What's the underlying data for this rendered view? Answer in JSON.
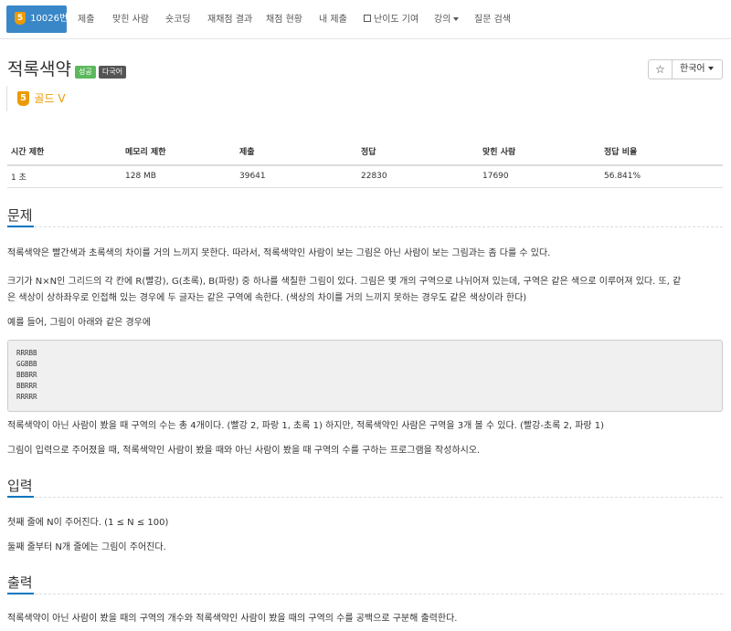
{
  "nav": {
    "active": {
      "tier_glyph": "5",
      "label": "10026번"
    },
    "items": [
      {
        "label": "제출"
      },
      {
        "label": "맞힌 사람"
      },
      {
        "label": "숏코딩"
      },
      {
        "label": "재채점 결과"
      },
      {
        "label": "채점 현황"
      },
      {
        "label": "내 제출"
      },
      {
        "label": "난이도 기여"
      },
      {
        "label": "강의"
      },
      {
        "label": "질문 검색"
      }
    ]
  },
  "problem": {
    "title": "적록색약",
    "labels": [
      "성공",
      "다국어"
    ],
    "tier_glyph": "5",
    "tier": "골드 V",
    "star": "☆",
    "language": "한국어"
  },
  "info_table": {
    "headers": [
      "시간 제한",
      "메모리 제한",
      "제출",
      "정답",
      "맞힌 사람",
      "정답 비율"
    ],
    "row": [
      "1 초",
      "128 MB",
      "39641",
      "22830",
      "17690",
      "56.841%"
    ]
  },
  "sections": {
    "problem": {
      "heading": "문제",
      "p1": "적록색약은 빨간색과 초록색의 차이를 거의 느끼지 못한다. 따라서, 적록색약인 사람이 보는 그림은 아닌 사람이 보는 그림과는 좀 다를 수 있다.",
      "p2a": "크기가 N×N인 그리드의 각 칸에 R(빨강), G(초록), B(파랑) 중 하나를 색칠한 그림이 있다. 그림은 몇 개의 구역으로 나뉘어져 있는데, 구역은 같은 색으로 이루어져 있다. 또, 같",
      "p2b": "은 색상이 상하좌우로 인접해 있는 경우에 두 글자는 같은 구역에 속한다. (색상의 차이를 거의 느끼지 못하는 경우도 같은 색상이라 한다)",
      "p3": "예를 들어, 그림이 아래와 같은 경우에",
      "grid": [
        "RRRBB",
        "GGBBB",
        "BBBRR",
        "BBRRR",
        "RRRRR"
      ],
      "p4": "적록색약이 아닌 사람이 봤을 때 구역의 수는 총 4개이다. (빨강 2, 파랑 1, 초록 1) 하지만, 적록색약인 사람은 구역을 3개 볼 수 있다. (빨강-초록 2, 파랑 1)",
      "p5": "그림이 입력으로 주어졌을 때, 적록색약인 사람이 봤을 때와 아닌 사람이 봤을 때 구역의 수를 구하는 프로그램을 작성하시오."
    },
    "input": {
      "heading": "입력",
      "p1": "첫째 줄에 N이 주어진다. (1 ≤ N ≤ 100)",
      "p2": "둘째 줄부터 N개 줄에는 그림이 주어진다."
    },
    "output": {
      "heading": "출력",
      "p1": "적록색약이 아닌 사람이 봤을 때의 구역의 개수와 적록색약인 사람이 봤을 때의 구역의 수를 공백으로 구분해 출력한다."
    }
  },
  "colors": {
    "nav_active": "#3a87c8",
    "tier_gold": "#ec9a00",
    "label_success": "#5cb85c",
    "label_dark": "#555555",
    "section_accent": "#0076c0"
  }
}
